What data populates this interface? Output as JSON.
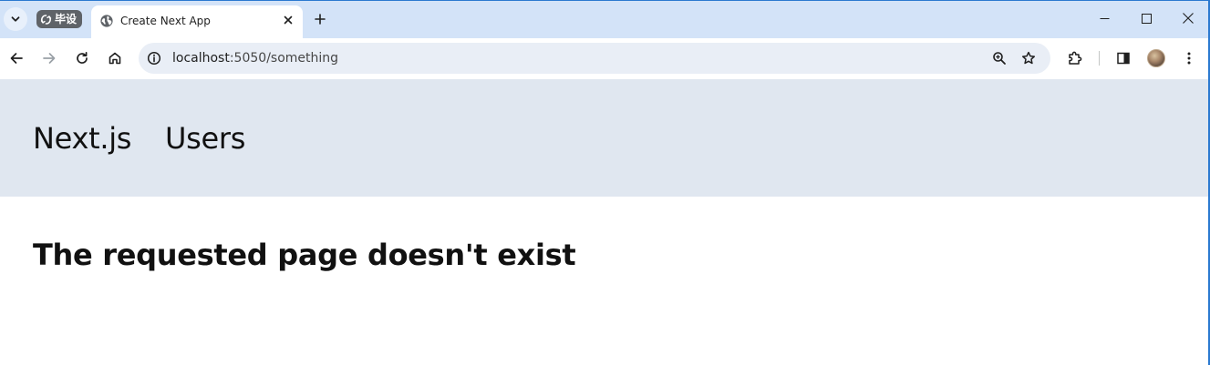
{
  "browser": {
    "tab_group_label": "毕设",
    "tab": {
      "title": "Create Next App"
    },
    "address": {
      "host": "localhost",
      "path": ":5050/something"
    },
    "icons": {
      "tab_search": "chevron-down-icon",
      "group": "sync-icon",
      "favicon": "globe-icon",
      "close_tab": "close-icon",
      "new_tab": "plus-icon",
      "minimize": "minimize-icon",
      "maximize": "maximize-icon",
      "close_window": "close-icon",
      "back": "arrow-left-icon",
      "forward": "arrow-right-icon",
      "reload": "reload-icon",
      "home": "home-icon",
      "site_info": "info-icon",
      "zoom": "zoom-icon",
      "bookmark": "star-icon",
      "extensions": "puzzle-icon",
      "side_panel": "side-panel-icon",
      "profile": "avatar",
      "menu": "more-vert-icon"
    },
    "colors": {
      "tab_strip": "#d3e3f8",
      "omnibox": "#e9eef6",
      "window_border": "#2b79d0"
    }
  },
  "page": {
    "nav": {
      "brand": "Next.js",
      "users": "Users"
    },
    "message": "The requested page doesn't exist",
    "colors": {
      "header_bg": "#e0e7f0",
      "text": "#111111"
    }
  }
}
